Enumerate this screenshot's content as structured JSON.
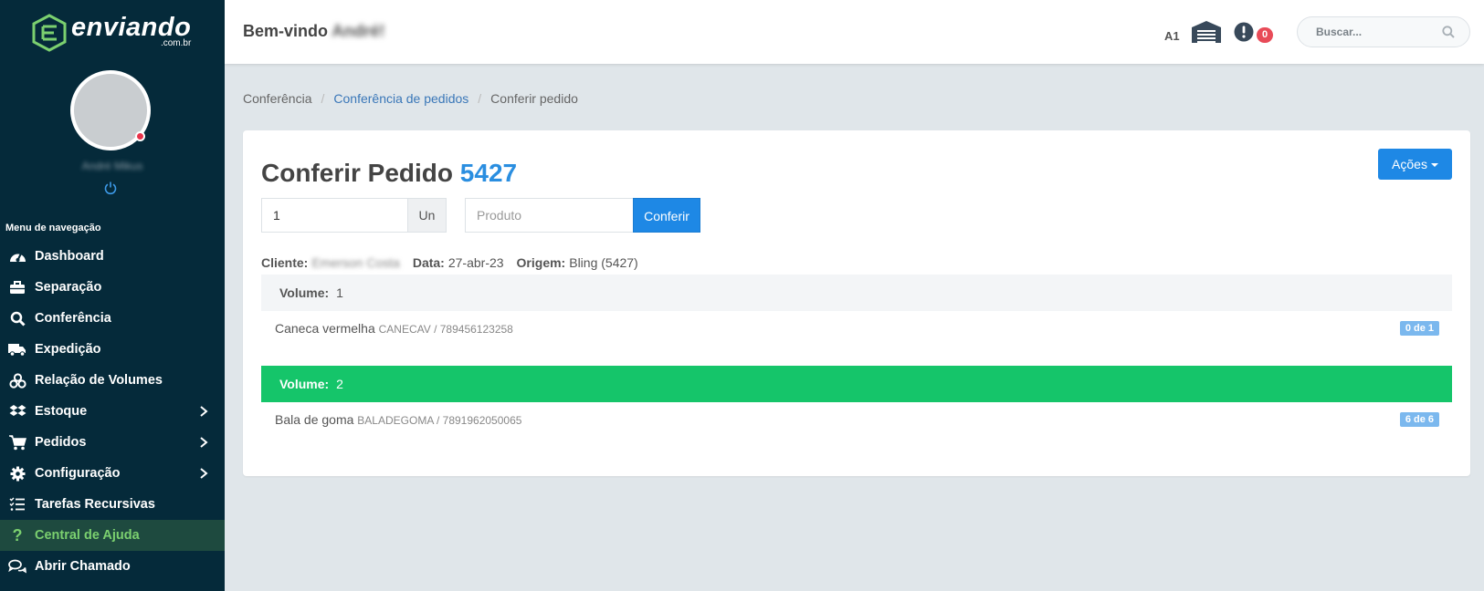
{
  "brand": {
    "name": "enviando",
    "domain": ".com.br",
    "accent": "#7bd06f"
  },
  "user": {
    "name": "André Mikus"
  },
  "sidebar": {
    "title": "Menu de navegação",
    "items": [
      {
        "label": "Dashboard",
        "icon": "dashboard-icon"
      },
      {
        "label": "Separação",
        "icon": "briefcase-icon"
      },
      {
        "label": "Conferência",
        "icon": "search-icon"
      },
      {
        "label": "Expedição",
        "icon": "truck-icon"
      },
      {
        "label": "Relação de Volumes",
        "icon": "boxes-icon"
      },
      {
        "label": "Estoque",
        "icon": "dropbox-icon"
      },
      {
        "label": "Pedidos",
        "icon": "cart-icon"
      },
      {
        "label": "Configuração",
        "icon": "gear-icon"
      },
      {
        "label": "Tarefas Recursivas",
        "icon": "tasks-icon"
      },
      {
        "label": "Central de Ajuda",
        "icon": "question-icon"
      },
      {
        "label": "Abrir Chamado",
        "icon": "chat-icon"
      }
    ]
  },
  "header": {
    "welcome": "Bem-vindo",
    "welcome_name": "André!",
    "warehouse_code": "A1",
    "alert_count": "0",
    "search_placeholder": "Buscar..."
  },
  "breadcrumb": {
    "root": "Conferência",
    "parent": "Conferência de pedidos",
    "current": "Conferir pedido"
  },
  "order": {
    "title": "Conferir Pedido",
    "number": "5427",
    "actions_label": "Ações",
    "quantity_value": "1",
    "unit": "Un",
    "product_placeholder": "Produto",
    "confirm_label": "Conferir",
    "client_label": "Cliente:",
    "client_value": "Emerson Costa",
    "date_label": "Data:",
    "date_value": "27-abr-23",
    "origin_label": "Origem:",
    "origin_value": "Bling (5427)"
  },
  "volumes": [
    {
      "label": "Volume:",
      "number": "1",
      "item_name": "Caneca vermelha",
      "item_sku": "CANECAV / 789456123258",
      "count": "0 de 1"
    },
    {
      "label": "Volume:",
      "number": "2",
      "item_name": "Bala de goma",
      "item_sku": "BALADEGOMA / 7891962050065",
      "count": "6 de 6"
    }
  ]
}
